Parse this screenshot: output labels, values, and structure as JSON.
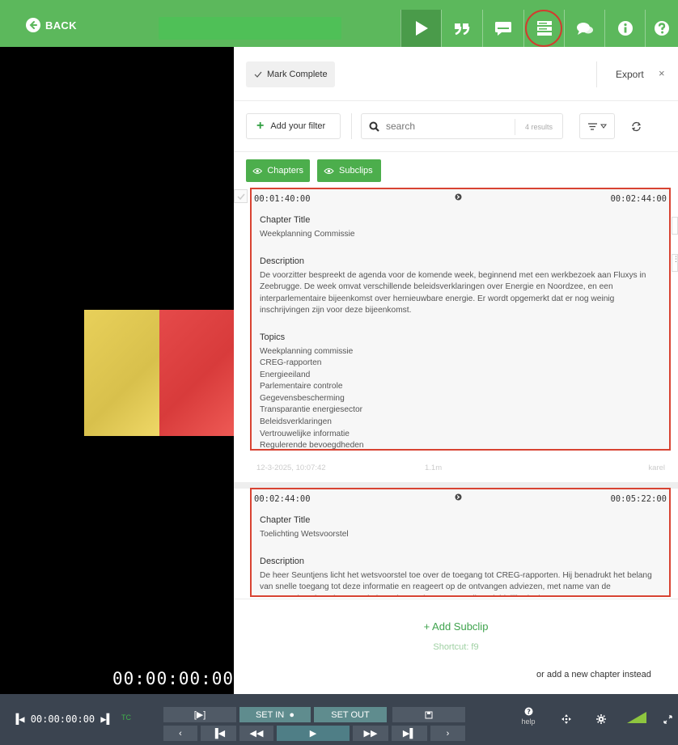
{
  "topbar": {
    "back_label": "BACK",
    "buttons": [
      {
        "name": "play-tab",
        "icon": "play-icon"
      },
      {
        "name": "quotes-tab",
        "icon": "quote-icon"
      },
      {
        "name": "subtitles-tab",
        "icon": "subtitle-icon"
      },
      {
        "name": "chapters-tab",
        "icon": "chapters-icon",
        "active": true
      },
      {
        "name": "comments-tab",
        "icon": "comments-icon"
      },
      {
        "name": "info-tab",
        "icon": "info-icon"
      },
      {
        "name": "help-tab",
        "icon": "help-icon"
      }
    ]
  },
  "video": {
    "timecode": "00:00:00:00"
  },
  "panel": {
    "mark_complete": "Mark Complete",
    "export": "Export",
    "close": "×",
    "add_filter": "Add your filter",
    "search_placeholder": "search",
    "results": "4 results",
    "chips": [
      "Chapters",
      "Subclips"
    ]
  },
  "clips": [
    {
      "tc_in": "00:01:40:00",
      "tc_out": "00:02:44:00",
      "title_label": "Chapter Title",
      "title": "Weekplanning Commissie",
      "desc_label": "Description",
      "description": "De voorzitter bespreekt de agenda voor de komende week, beginnend met een werkbezoek aan Fluxys in Zeebrugge. De week omvat verschillende beleidsverklaringen over Energie en Noordzee, en een interparlementaire bijeenkomst over hernieuwbare energie. Er wordt opgemerkt dat er nog weinig inschrijvingen zijn voor deze bijeenkomst.",
      "topics_label": "Topics",
      "topics": [
        "Weekplanning commissie",
        "CREG-rapporten",
        "Energieeiland",
        "Parlementaire controle",
        "Gegevensbescherming",
        "Transparantie energiesector",
        "Beleidsverklaringen",
        "Vertrouwelijke informatie",
        "Regulerende bevoegdheden"
      ],
      "meta_date": "12-3-2025, 10:07:42",
      "meta_duration": "1.1m",
      "meta_user": "karel"
    },
    {
      "tc_in": "00:02:44:00",
      "tc_out": "00:05:22:00",
      "title_label": "Chapter Title",
      "title": "Toelichting Wetsvoorstel",
      "desc_label": "Description",
      "description": "De heer Seuntjens licht het wetsvoorstel toe over de toegang tot CREG-rapporten. Hij benadrukt het belang van snelle toegang tot deze informatie en reageert op de ontvangen adviezen, met name van de Gegevensbeschermingsautoriteit en de Raad van State. Hij verduidelijkt dat het"
    }
  ],
  "add_subclip": "+ Add Subclip",
  "shortcut": "Shortcut: f9",
  "add_chapter": "or add a new chapter instead",
  "bottombar": {
    "timecode": "00:00:00:00",
    "tc_label": "TC",
    "set_in": "SET IN",
    "set_out": "SET OUT",
    "help": "help"
  },
  "colors": {
    "brand_green": "#5cb85c",
    "highlight_red": "#d84332",
    "bottom_bar": "#3b4450"
  }
}
